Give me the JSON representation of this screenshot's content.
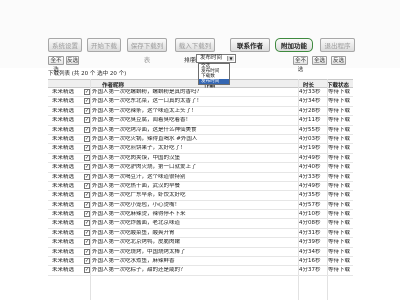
{
  "toolbar": {
    "buttons": [
      {
        "label": "系统设置",
        "active": false
      },
      {
        "label": "开始下载",
        "active": false
      },
      {
        "label": "保存下载列表",
        "active": false
      },
      {
        "label": "载入下载列表",
        "active": false
      },
      {
        "label": "联系作者",
        "active": true
      },
      {
        "label": "附加功能",
        "active": true
      },
      {
        "label": "退出程序",
        "active": false
      }
    ]
  },
  "side_left": [
    "全不选",
    "反选"
  ],
  "sort": {
    "label": "排序:",
    "selected": "发布时间",
    "options": [
      "全选",
      "发布时间",
      "下载数",
      "发布时间"
    ],
    "highlighted_index": 3
  },
  "side_right": [
    "全不选",
    "全选",
    "反选"
  ],
  "info_text": "下载列表 (共 20 个 选中 20 个)",
  "columns": {
    "author": "作者昵称",
    "title": "作品",
    "time": "时长",
    "status": "下载状态"
  },
  "rows": [
    {
      "author": "未来精选",
      "title": "外国人第一次吃螺蛳粉，螺蛳粉是真的香吗？",
      "time": "4分33秒",
      "status": "等待下载"
    },
    {
      "author": "未来精选",
      "title": "外国人第一次吃东北菜，这一口真的太香了！",
      "time": "4分34秒",
      "status": "等待下载"
    },
    {
      "author": "未来精选",
      "title": "外国人第一次吃辣条，这个味道太上头了！",
      "time": "4分28秒",
      "status": "等待下载"
    },
    {
      "author": "未来精选",
      "title": "外国人第一次吃臭豆腐，闻着臭吃着香！",
      "time": "4分11秒",
      "status": "等待下载"
    },
    {
      "author": "未来精选",
      "title": "外国人第一次吃烤冷面，这是什么神仙美食",
      "time": "4分55秒",
      "status": "等待下载"
    },
    {
      "author": "未来精选",
      "title": "外国人第一次吃火锅，辣得直喝水 #外国人",
      "time": "4分03秒",
      "status": "等待下载"
    },
    {
      "author": "未来精选",
      "title": "外国人第一次吃煎饼果子，太好吃了！",
      "time": "4分19秒",
      "status": "等待下载"
    },
    {
      "author": "未来精选",
      "title": "外国人第一次吃肉夹馍，中国的汉堡",
      "time": "4分49秒",
      "status": "等待下载"
    },
    {
      "author": "未来精选",
      "title": "外国人第一次吃驴肉火烧，第一口就爱上了",
      "time": "4分40秒",
      "status": "等待下载"
    },
    {
      "author": "未来精选",
      "title": "外国人第一次喝豆汁，这个味道很特别",
      "time": "4分33秒",
      "status": "等待下载"
    },
    {
      "author": "未来精选",
      "title": "外国人第一次吃热干面，武汉的早餐",
      "time": "4分49秒",
      "status": "等待下载"
    },
    {
      "author": "未来精选",
      "title": "外国人第一次吃广东早茶，虾饺太好吃",
      "time": "4分35秒",
      "status": "等待下载"
    },
    {
      "author": "未来精选",
      "title": "外国人第一次吃小笼包，小心烫嘴！",
      "time": "4分57秒",
      "status": "等待下载"
    },
    {
      "author": "未来精选",
      "title": "外国人第一次吃麻辣烫，辣得停不下来",
      "time": "4分10秒",
      "status": "等待下载"
    },
    {
      "author": "未来精选",
      "title": "外国人第一次吃炸酱面，老北京味道",
      "time": "4分08秒",
      "status": "等待下载"
    },
    {
      "author": "未来精选",
      "title": "外国人第一次吃酸菜鱼，酸爽开胃",
      "time": "4分31秒",
      "status": "等待下载"
    },
    {
      "author": "未来精选",
      "title": "外国人第一次吃北京烤鸭，皮脆肉嫩",
      "time": "4分39秒",
      "status": "等待下载"
    },
    {
      "author": "未来精选",
      "title": "外国人第一次吃烧烤，中国烧烤太棒了",
      "time": "4分34秒",
      "status": "等待下载"
    },
    {
      "author": "未来精选",
      "title": "外国人第一次吃水煮鱼，麻辣鲜香",
      "time": "4分16秒",
      "status": "等待下载"
    },
    {
      "author": "未来精选",
      "title": "外国人第一次吃粽子，甜的还是咸的？",
      "time": "4分37秒",
      "status": "等待下载"
    }
  ]
}
